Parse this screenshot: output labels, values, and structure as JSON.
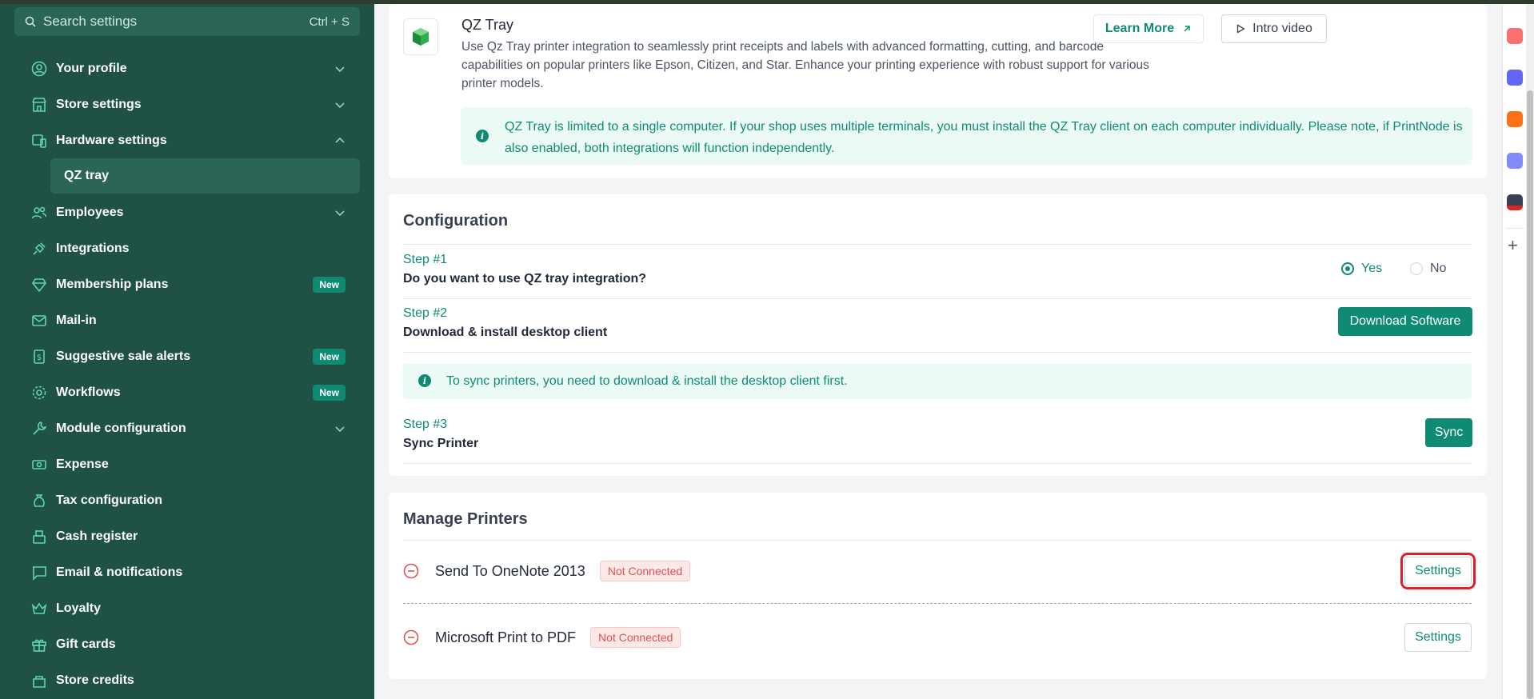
{
  "search": {
    "placeholder": "Search settings",
    "shortcut": "Ctrl + S"
  },
  "sidebar": {
    "items": [
      {
        "label": "Your profile",
        "icon": "user-circle-icon",
        "chevron": "down"
      },
      {
        "label": "Store settings",
        "icon": "store-icon",
        "chevron": "down"
      },
      {
        "label": "Hardware settings",
        "icon": "devices-icon",
        "chevron": "up"
      },
      {
        "label": "QZ tray",
        "sub": true
      },
      {
        "label": "Employees",
        "icon": "users-icon",
        "chevron": "down"
      },
      {
        "label": "Integrations",
        "icon": "plug-icon"
      },
      {
        "label": "Membership plans",
        "icon": "diamond-icon",
        "badge": "New"
      },
      {
        "label": "Mail-in",
        "icon": "mail-icon"
      },
      {
        "label": "Suggestive sale alerts",
        "icon": "dollar-icon",
        "badge": "New"
      },
      {
        "label": "Workflows",
        "icon": "gear-icon",
        "badge": "New"
      },
      {
        "label": "Module configuration",
        "icon": "wrench-icon",
        "chevron": "down"
      },
      {
        "label": "Expense",
        "icon": "cash-icon"
      },
      {
        "label": "Tax configuration",
        "icon": "money-bag-icon"
      },
      {
        "label": "Cash register",
        "icon": "register-icon"
      },
      {
        "label": "Email & notifications",
        "icon": "message-icon"
      },
      {
        "label": "Loyalty",
        "icon": "crown-icon"
      },
      {
        "label": "Gift cards",
        "icon": "gift-icon"
      },
      {
        "label": "Store credits",
        "icon": "credit-icon"
      }
    ]
  },
  "qz": {
    "title": "QZ Tray",
    "description": "Use Qz Tray printer integration to seamlessly print receipts and labels with advanced formatting, cutting, and barcode capabilities on popular printers like Epson, Citizen, and Star. Enhance your printing experience with robust support for various printer models.",
    "learn_more": "Learn More",
    "intro_video": "Intro video",
    "info": "QZ Tray is limited to a single computer. If your shop uses multiple terminals, you must install the QZ Tray client on each computer individually. Please note, if PrintNode is also enabled, both integrations will function independently."
  },
  "config": {
    "title": "Configuration",
    "step1": {
      "label": "Step #1",
      "text": "Do you want to use QZ tray integration?",
      "yes": "Yes",
      "no": "No",
      "selected": "Yes"
    },
    "step2": {
      "label": "Step #2",
      "text": "Download & install desktop client",
      "button": "Download Software"
    },
    "sync_note": "To sync printers, you need to download & install the desktop client first.",
    "step3": {
      "label": "Step #3",
      "text": "Sync Printer",
      "button": "Sync"
    }
  },
  "printers": {
    "title": "Manage Printers",
    "items": [
      {
        "name": "Send To OneNote 2013",
        "status": "Not Connected",
        "button": "Settings"
      },
      {
        "name": "Microsoft Print to PDF",
        "status": "Not Connected",
        "button": "Settings"
      }
    ]
  },
  "colors": {
    "sidebar_bg": "#1f5245",
    "accent": "#0f8b74",
    "danger": "#e05252",
    "highlight": "#e11d2a"
  }
}
